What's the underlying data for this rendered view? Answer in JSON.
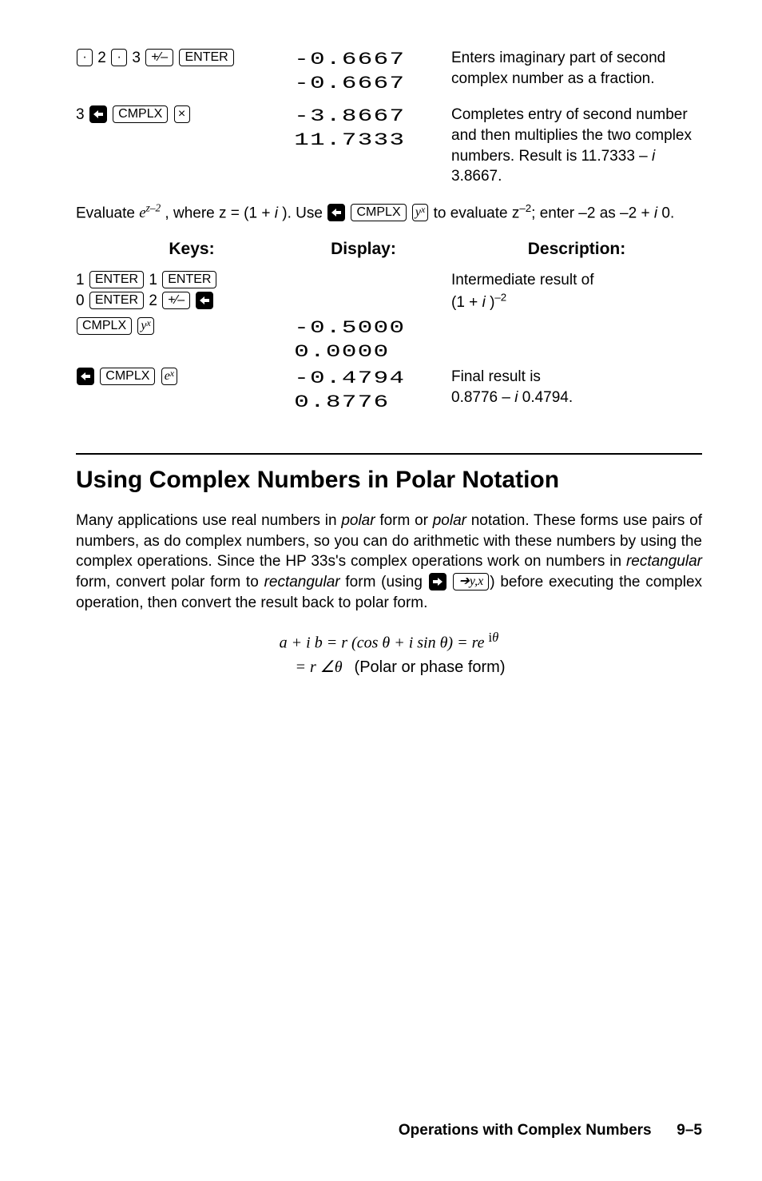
{
  "table1": {
    "rows": [
      {
        "disp": "-0.6667\n-0.6667",
        "desc": "Enters imaginary part of second complex number as a fraction."
      },
      {
        "disp": "-3.8667\n11.7333",
        "desc_parts": [
          "Completes entry of second number and then multiplies the two complex numbers. Result is 11.7333 – ",
          "i",
          " 3.8667."
        ]
      }
    ]
  },
  "mid_para": {
    "pre": "Evaluate ",
    "expr_a": "e",
    "expr_exp": "z–2",
    "mid1": " , where z = (1 + ",
    "i1": "i",
    "mid2": " ). Use ",
    "mid3": " to evaluate z",
    "exp_neg2": "–2",
    "mid4": "; enter –2 as –2 + ",
    "i2": "i",
    "mid5": " 0."
  },
  "headers": {
    "keys": "Keys:",
    "disp": "Display:",
    "desc": "Description:"
  },
  "table2": {
    "row1": {
      "desc_a": "Intermediate result of",
      "desc_b": "(1 + i )–2"
    },
    "row2": {
      "disp": "-0.5000\n0.0000"
    },
    "row3": {
      "disp": "-0.4794\n0.8776",
      "desc_a": "Final result is",
      "desc_b1": "0.8776 – ",
      "desc_b2": "i",
      "desc_b3": " 0.4794."
    }
  },
  "section_title": "Using Complex Numbers in Polar Notation",
  "body_para": {
    "p1": "Many applications use real numbers in ",
    "p2": "polar",
    "p3": " form or ",
    "p4": "polar",
    "p5": " notation. These forms use pairs of numbers, as do complex numbers, so you can do arithmetic with these numbers by using the complex operations. Since the HP 33s's complex operations work on numbers in ",
    "p6": "rectangular",
    "p7": " form, convert polar form to ",
    "p8": "rectangular",
    "p9": " form (using ",
    "p10": ") before executing the complex operation, then convert the result back to polar form."
  },
  "equation": {
    "line1": "a + i b = r (cos θ + i sin θ) = re iθ",
    "line2": " = r ∠θ   (Polar or phase form)"
  },
  "keycaps": {
    "dot": "·",
    "two": "2",
    "three": "3",
    "pm": "+∕–",
    "enter": "ENTER",
    "cmplx": "CMPLX",
    "x": "×",
    "yx": "y",
    "yx_sup": "x",
    "ex": "e",
    "ex_sup": "x",
    "one": "1",
    "zero": "0",
    "toyx": "➔y,x"
  },
  "footer": {
    "label": "Operations with Complex Numbers",
    "page": "9–5"
  }
}
